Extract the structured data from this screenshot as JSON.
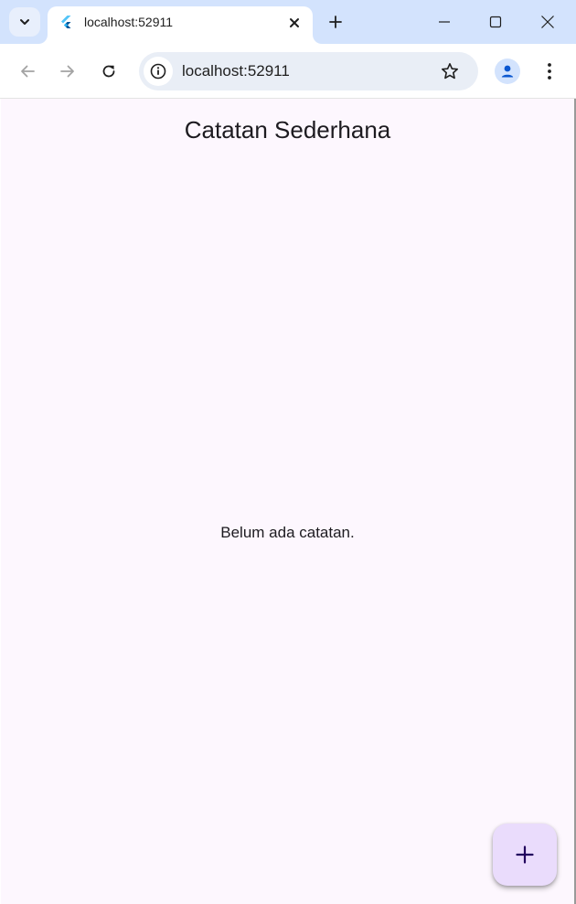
{
  "browser": {
    "tab": {
      "title": "localhost:52911"
    },
    "address_bar": {
      "url": "localhost:52911"
    },
    "icons": {
      "tab_search": "chevron-down-icon",
      "favicon": "flutter-logo-icon",
      "tab_close": "close-icon",
      "new_tab": "plus-icon",
      "minimize": "minimize-icon",
      "maximize": "maximize-icon",
      "window_close": "close-icon",
      "back": "arrow-left-icon",
      "forward": "arrow-right-icon",
      "reload": "reload-icon",
      "site_info": "info-icon",
      "bookmark": "star-icon",
      "profile": "person-icon",
      "menu": "more-vertical-icon"
    },
    "colors": {
      "tabstrip": "#d3e3fd",
      "omnibox": "#e9eef6"
    }
  },
  "app": {
    "title": "Catatan Sederhana",
    "empty_message": "Belum ada catatan.",
    "fab_icon": "plus-icon",
    "colors": {
      "background": "#fdf7fe",
      "fab": "#eadcfc",
      "fab_icon": "#21005d",
      "text": "#1d1b20"
    }
  }
}
